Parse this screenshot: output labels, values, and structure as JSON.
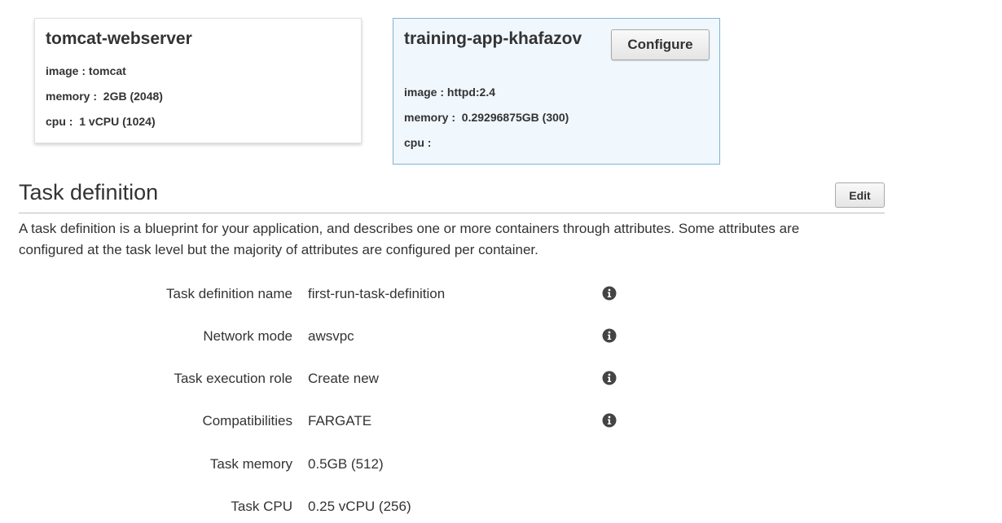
{
  "containers": [
    {
      "name": "tomcat-webserver",
      "image_label": "image : ",
      "image": "tomcat",
      "memory_label": "memory : ",
      "memory": " 2GB (2048)",
      "cpu_label": "cpu : ",
      "cpu": " 1 vCPU (1024)"
    },
    {
      "name": "training-app-khafazov",
      "image_label": "image : ",
      "image": "httpd:2.4",
      "memory_label": "memory : ",
      "memory": " 0.29296875GB (300)",
      "cpu_label": "cpu : ",
      "cpu": "",
      "configure_label": "Configure"
    }
  ],
  "task_definition": {
    "title": "Task definition",
    "edit_label": "Edit",
    "description": "A task definition is a blueprint for your application, and describes one or more containers through attributes. Some attributes are configured at the task level but the majority of attributes are configured per container.",
    "rows": [
      {
        "label": "Task definition name",
        "value": "first-run-task-definition",
        "info_icon": "info-icon"
      },
      {
        "label": "Network mode",
        "value": "awsvpc",
        "info_icon": "info-icon"
      },
      {
        "label": "Task execution role",
        "value": "Create new",
        "info_icon": "info-icon"
      },
      {
        "label": "Compatibilities",
        "value": "FARGATE",
        "info_icon": "info-icon"
      },
      {
        "label": "Task memory",
        "value": "0.5GB (512)"
      },
      {
        "label": "Task CPU",
        "value": "0.25 vCPU (256)"
      }
    ]
  },
  "colors": {
    "selected_card_bg": "#f0f7fd",
    "selected_card_border": "#7fb3d9",
    "text": "#333333"
  }
}
